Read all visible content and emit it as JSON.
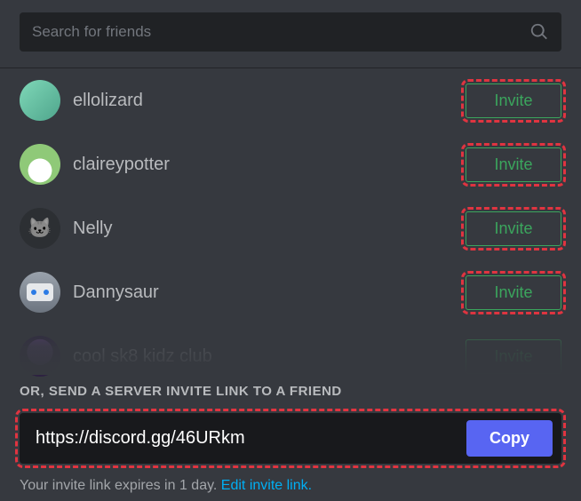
{
  "search": {
    "placeholder": "Search for friends"
  },
  "invite_label": "Invite",
  "friends": [
    {
      "name": "ellolizard",
      "highlighted": true,
      "avatar_class": "av1"
    },
    {
      "name": "claireypotter",
      "highlighted": true,
      "avatar_class": "av2"
    },
    {
      "name": "Nelly",
      "highlighted": true,
      "avatar_class": "av3"
    },
    {
      "name": "Dannysaur",
      "highlighted": true,
      "avatar_class": "av4"
    },
    {
      "name": "cool sk8 kidz club",
      "highlighted": false,
      "avatar_class": "av5"
    }
  ],
  "bottom": {
    "or_label": "OR, SEND A SERVER INVITE LINK TO A FRIEND",
    "link": "https://discord.gg/46URkm",
    "copy_label": "Copy",
    "expire_text": "Your invite link expires in 1 day. ",
    "edit_link": "Edit invite link.",
    "highlighted": true
  }
}
